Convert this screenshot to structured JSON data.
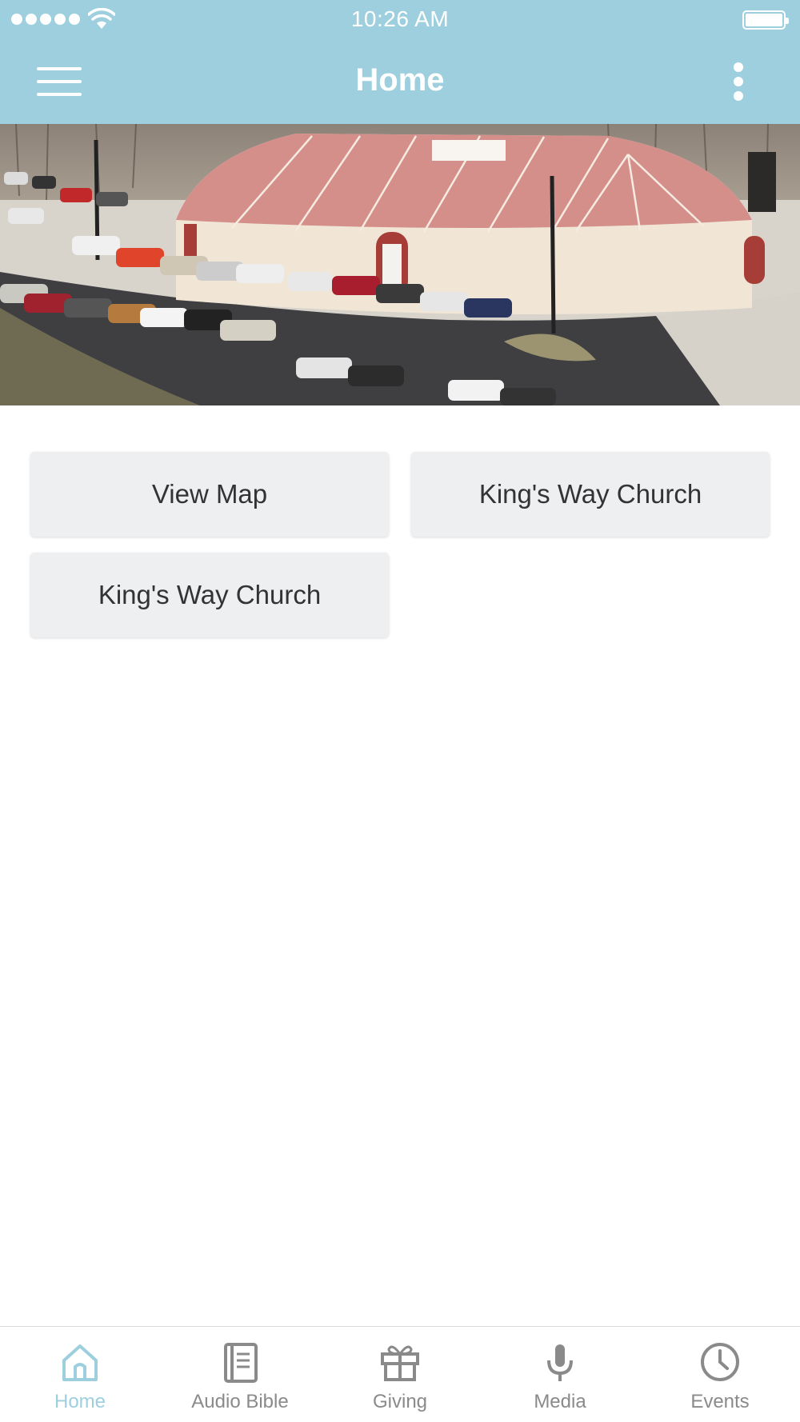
{
  "status_bar": {
    "time": "10:26 AM"
  },
  "nav": {
    "title": "Home"
  },
  "buttons": [
    {
      "label": "View Map"
    },
    {
      "label": "King's Way Church"
    },
    {
      "label": "King's Way Church"
    }
  ],
  "tabs": [
    {
      "label": "Home",
      "icon": "home-icon",
      "active": true
    },
    {
      "label": "Audio Bible",
      "icon": "book-icon",
      "active": false
    },
    {
      "label": "Giving",
      "icon": "gift-icon",
      "active": false
    },
    {
      "label": "Media",
      "icon": "microphone-icon",
      "active": false
    },
    {
      "label": "Events",
      "icon": "clock-icon",
      "active": false
    }
  ],
  "colors": {
    "header": "#9ecfdf",
    "tab_active": "#9ecfdf",
    "tab_inactive": "#8a8a8a",
    "button_bg": "#eeeff1"
  }
}
